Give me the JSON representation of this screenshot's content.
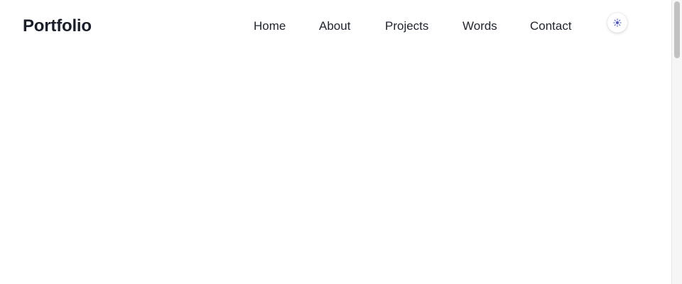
{
  "header": {
    "brand": "Portfolio",
    "nav": [
      {
        "label": "Home"
      },
      {
        "label": "About"
      },
      {
        "label": "Projects"
      },
      {
        "label": "Words"
      },
      {
        "label": "Contact"
      }
    ],
    "theme_toggle": {
      "icon": "sun-icon",
      "accent_color": "#4f5bd5"
    }
  }
}
